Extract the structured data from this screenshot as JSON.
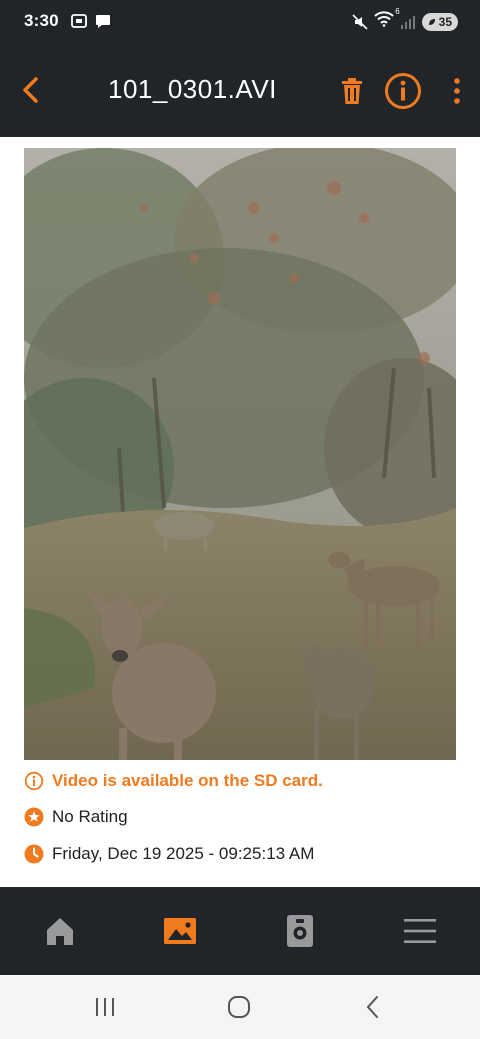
{
  "status_bar": {
    "time": "3:30",
    "battery": "35",
    "wifi_badge": "6"
  },
  "app_bar": {
    "title": "101_0301.AVI"
  },
  "details": {
    "sd_notice": "Video is available on the SD card.",
    "rating": "No Rating",
    "datetime": "Friday, Dec 19 2025 - 09:25:13 AM"
  },
  "colors": {
    "accent": "#f07a1f",
    "bar_bg": "#212428",
    "icon_gray": "#9a9a9a"
  },
  "icons": {
    "back": "chevron-left-icon",
    "delete": "trash-icon",
    "info": "info-circle-icon",
    "more": "more-vertical-icon",
    "nav_home": "home-icon",
    "nav_gallery": "photo-gallery-icon",
    "nav_camera": "trail-camera-icon",
    "nav_menu": "hamburger-menu-icon"
  },
  "bottom_nav": {
    "active": "gallery"
  }
}
